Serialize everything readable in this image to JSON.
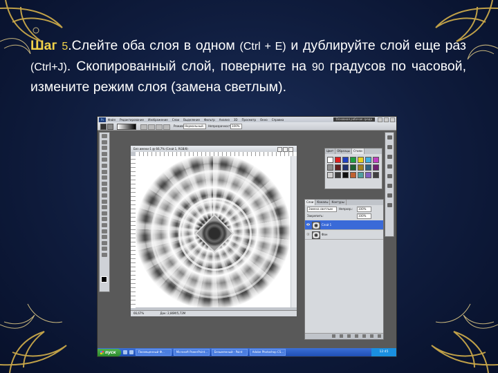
{
  "caption": {
    "step_label": "Шаг ",
    "step_number": "5",
    "text_a": ".Слейте оба слоя в одном ",
    "shortcut_merge": "(Ctrl + E)",
    "text_b": " и дублируйте слой еще раз ",
    "shortcut_dup": "(Ctrl+J)",
    "text_c": ". Скопированный слой, поверните на ",
    "degrees": "90",
    "text_d": " градусов по часовой, измените режим слоя (замена светлым)."
  },
  "photoshop": {
    "menu": {
      "logo": "Ps",
      "items": [
        "Файл",
        "Редактирование",
        "Изображение",
        "Слои",
        "Выделение",
        "Фильтр",
        "Анализ",
        "3D",
        "Просмотр",
        "Окно",
        "Справка"
      ],
      "workspace": "Основная рабочая среда"
    },
    "options": {
      "mode_label": "Режим:",
      "mode_value": "Нормальный",
      "opacity_label": "Непрозрачность:",
      "opacity_value": "100%"
    },
    "document": {
      "title": "Без имени-1 @ 66,7% (Слой 1, RGB/8)",
      "zoom": "66,67%",
      "doc_info": "Док: 2,86M/5,72M"
    },
    "swatches_panel": {
      "tabs": [
        "Цвет",
        "Образцы",
        "Стили"
      ],
      "colors": [
        "#ffffff",
        "#e02020",
        "#2040c0",
        "#20a040",
        "#e8d020",
        "#40b0e0",
        "#c040c0",
        "#909090",
        "#602020",
        "#203070",
        "#206030",
        "#a08020",
        "#306080",
        "#702070",
        "#d0d0d0",
        "#3a3a3a",
        "#101010",
        "#c06030",
        "#50a0a0",
        "#8060c0",
        "#404040"
      ]
    },
    "layers_panel": {
      "tabs": [
        "Слои",
        "Каналы",
        "Контуры"
      ],
      "blend_mode": "Замена светлым",
      "opacity_label": "Непрозр.:",
      "opacity_value": "100%",
      "fill_label": "Закрепить:",
      "fill_value": "100%",
      "layers": [
        {
          "name": "Слой 1",
          "selected": true
        },
        {
          "name": "Фон",
          "selected": false
        }
      ]
    },
    "taskbar": {
      "start": "пуск",
      "tasks": [
        "Посвященный Ф...",
        "Microsoft PowerPoint...",
        "Безымянный - Paint",
        "Adobe Photoshop CS..."
      ],
      "clock": "12:45"
    }
  }
}
